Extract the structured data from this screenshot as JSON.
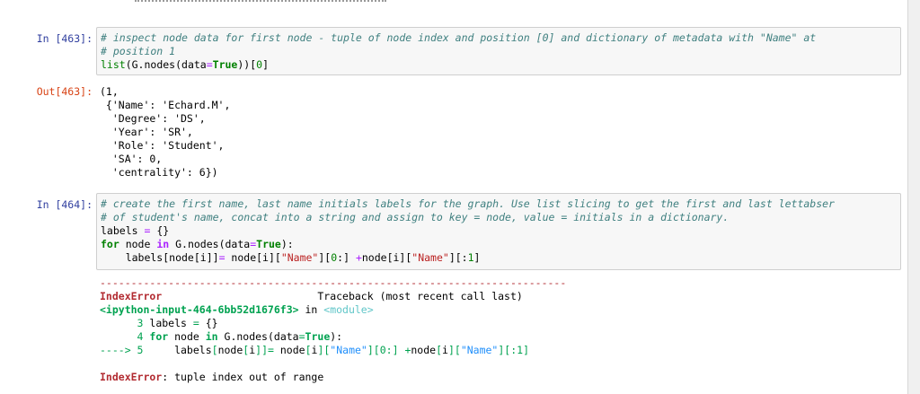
{
  "cells": [
    {
      "prompt": "In [463]:",
      "input_lines": [
        "# inspect node data for first node - tuple of node index and position [0] and dictionary of metadata with \"Name\" at",
        "# position 1",
        "list(G.nodes(data=True))[0]"
      ],
      "out_prompt": "Out[463]:",
      "output_lines": [
        "(1,",
        " {'Name': 'Echard.M',",
        "  'Degree': 'DS',",
        "  'Year': 'SR',",
        "  'Role': 'Student',",
        "  'SA': 0,",
        "  'centrality': 6})"
      ]
    },
    {
      "prompt": "In [464]:",
      "input_lines": [
        "# create the first name, last name initials labels for the graph. Use list slicing to get the first and last lettabser",
        "# of student's name, concat into a string and assign to key = node, value = initials in a dictionary.",
        "labels = {}",
        "for node in G.nodes(data=True):",
        "    labels[node[i]]= node[i][\"Name\"][0:] +node[i][\"Name\"][:1]"
      ],
      "traceback": {
        "dashes": "---------------------------------------------------------------------------",
        "error_name": "IndexError",
        "header_right": "Traceback (most recent call last)",
        "location": "<ipython-input-464-6bb52d1676f3>",
        "in_word": " in ",
        "module": "<module>",
        "frame_lines": [
          {
            "num": "      3",
            "code": " labels = {}"
          },
          {
            "num": "      4",
            "code": " for node in G.nodes(data=True):"
          },
          {
            "num": "----> 5",
            "code": "     labels[node[i]]= node[i][\"Name\"][0:] +node[i][\"Name\"][:1]"
          }
        ],
        "final_error_name": "IndexError",
        "final_message": ": tuple index out of range"
      }
    }
  ]
}
